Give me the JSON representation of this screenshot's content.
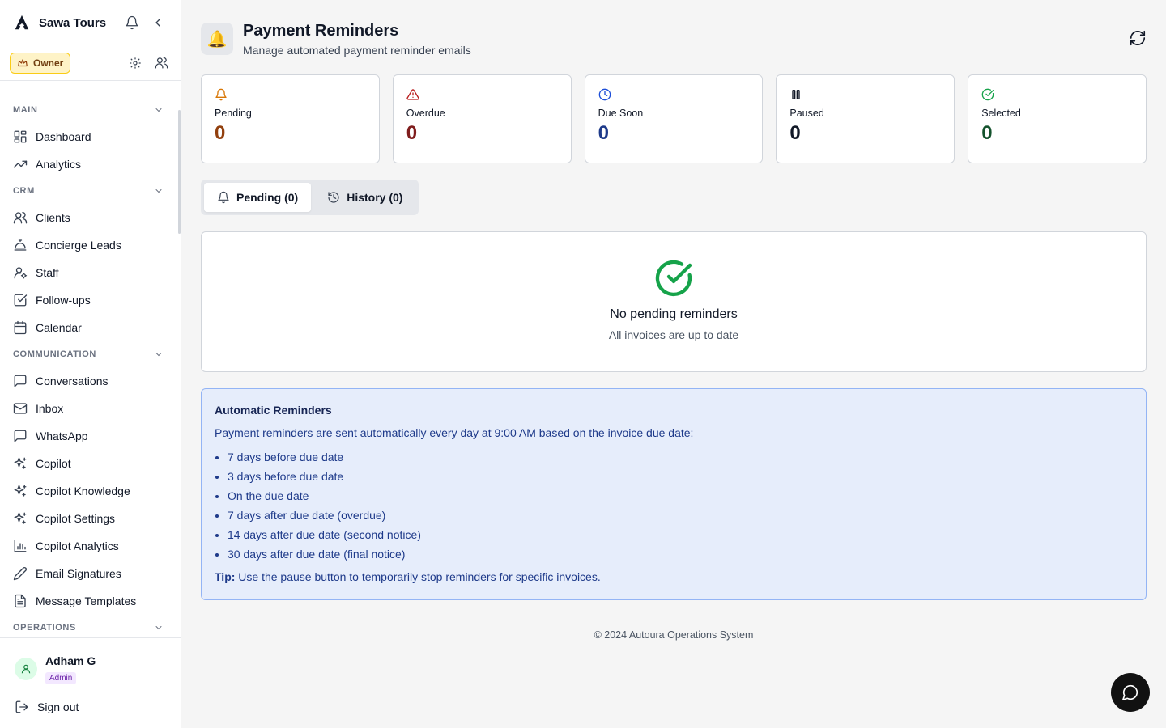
{
  "brand": {
    "name": "Sawa Tours"
  },
  "role": {
    "badge": "Owner"
  },
  "nav": {
    "sections": [
      {
        "label": "MAIN",
        "items": [
          {
            "label": "Dashboard",
            "icon": "dashboard-icon"
          },
          {
            "label": "Analytics",
            "icon": "trending-icon"
          }
        ]
      },
      {
        "label": "CRM",
        "items": [
          {
            "label": "Clients",
            "icon": "users-icon"
          },
          {
            "label": "Concierge Leads",
            "icon": "concierge-bell-icon"
          },
          {
            "label": "Staff",
            "icon": "user-cog-icon"
          },
          {
            "label": "Follow-ups",
            "icon": "checkbox-icon"
          },
          {
            "label": "Calendar",
            "icon": "calendar-icon"
          }
        ]
      },
      {
        "label": "COMMUNICATION",
        "items": [
          {
            "label": "Conversations",
            "icon": "message-square-icon"
          },
          {
            "label": "Inbox",
            "icon": "mail-icon"
          },
          {
            "label": "WhatsApp",
            "icon": "message-square-icon"
          },
          {
            "label": "Copilot",
            "icon": "sparkles-icon"
          },
          {
            "label": "Copilot Knowledge",
            "icon": "sparkles-icon"
          },
          {
            "label": "Copilot Settings",
            "icon": "sparkles-icon"
          },
          {
            "label": "Copilot Analytics",
            "icon": "bar-chart-icon"
          },
          {
            "label": "Email Signatures",
            "icon": "pen-icon"
          },
          {
            "label": "Message Templates",
            "icon": "file-text-icon"
          }
        ]
      },
      {
        "label": "OPERATIONS",
        "items": []
      }
    ]
  },
  "user": {
    "name": "Adham G",
    "role_badge": "Admin",
    "signout_label": "Sign out"
  },
  "page": {
    "title": "Payment Reminders",
    "subtitle": "Manage automated payment reminder emails",
    "header_icon": "🔔"
  },
  "stats": [
    {
      "label": "Pending",
      "value": "0",
      "color": "#92400e",
      "icon_color": "#d97706",
      "icon": "bell-icon"
    },
    {
      "label": "Overdue",
      "value": "0",
      "color": "#7f1d1d",
      "icon_color": "#b91c1c",
      "icon": "alert-triangle-icon"
    },
    {
      "label": "Due Soon",
      "value": "0",
      "color": "#1e3a8a",
      "icon_color": "#1d4ed8",
      "icon": "clock-icon"
    },
    {
      "label": "Paused",
      "value": "0",
      "color": "#111827",
      "icon_color": "#111827",
      "icon": "pause-icon"
    },
    {
      "label": "Selected",
      "value": "0",
      "color": "#14532d",
      "icon_color": "#16a34a",
      "icon": "check-circle-icon"
    }
  ],
  "tabs": [
    {
      "label": "Pending (0)",
      "active": true,
      "icon": "bell-icon"
    },
    {
      "label": "History (0)",
      "active": false,
      "icon": "history-icon"
    }
  ],
  "empty": {
    "title": "No pending reminders",
    "subtitle": "All invoices are up to date",
    "icon_color": "#16a34a"
  },
  "info": {
    "title": "Automatic Reminders",
    "description": "Payment reminders are sent automatically every day at 9:00 AM based on the invoice due date:",
    "items": [
      "7 days before due date",
      "3 days before due date",
      "On the due date",
      "7 days after due date (overdue)",
      "14 days after due date (second notice)",
      "30 days after due date (final notice)"
    ],
    "tip_label": "Tip:",
    "tip_text": " Use the pause button to temporarily stop reminders for specific invoices."
  },
  "footer": {
    "text": "© 2024 Autoura Operations System"
  }
}
